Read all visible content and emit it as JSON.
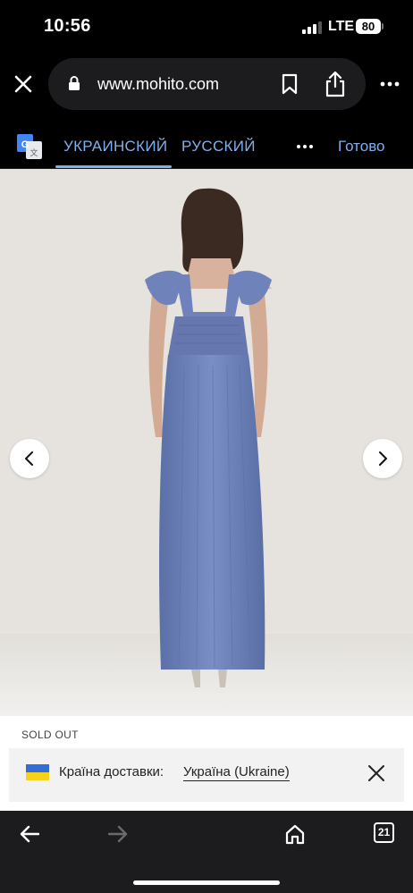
{
  "status_bar": {
    "time": "10:56",
    "network": "LTE",
    "battery": "80"
  },
  "browser": {
    "url": "www.mohito.com",
    "icons": [
      "close-icon",
      "lock-icon",
      "bookmark-icon",
      "share-icon",
      "more-icon"
    ]
  },
  "translate_bar": {
    "icon": "google-translate-icon",
    "source_language": "УКРАИНСКИЙ",
    "target_language": "РУССКИЙ",
    "done_label": "Готово",
    "accent_color": "#7fb0ea"
  },
  "product": {
    "image": "long-blue-tulle-dress-back-view",
    "dress_color": "#6b80b8",
    "status": "SOLD OUT"
  },
  "delivery_banner": {
    "label": "Країна доставки:",
    "country": "Україна (Ukraine)",
    "flag_colors": [
      "#2f6fd6",
      "#f7d21c"
    ]
  },
  "toolbar": {
    "tab_count": "21",
    "icons": [
      "back-arrow-icon",
      "forward-arrow-icon",
      "home-icon",
      "tabs-icon"
    ]
  }
}
